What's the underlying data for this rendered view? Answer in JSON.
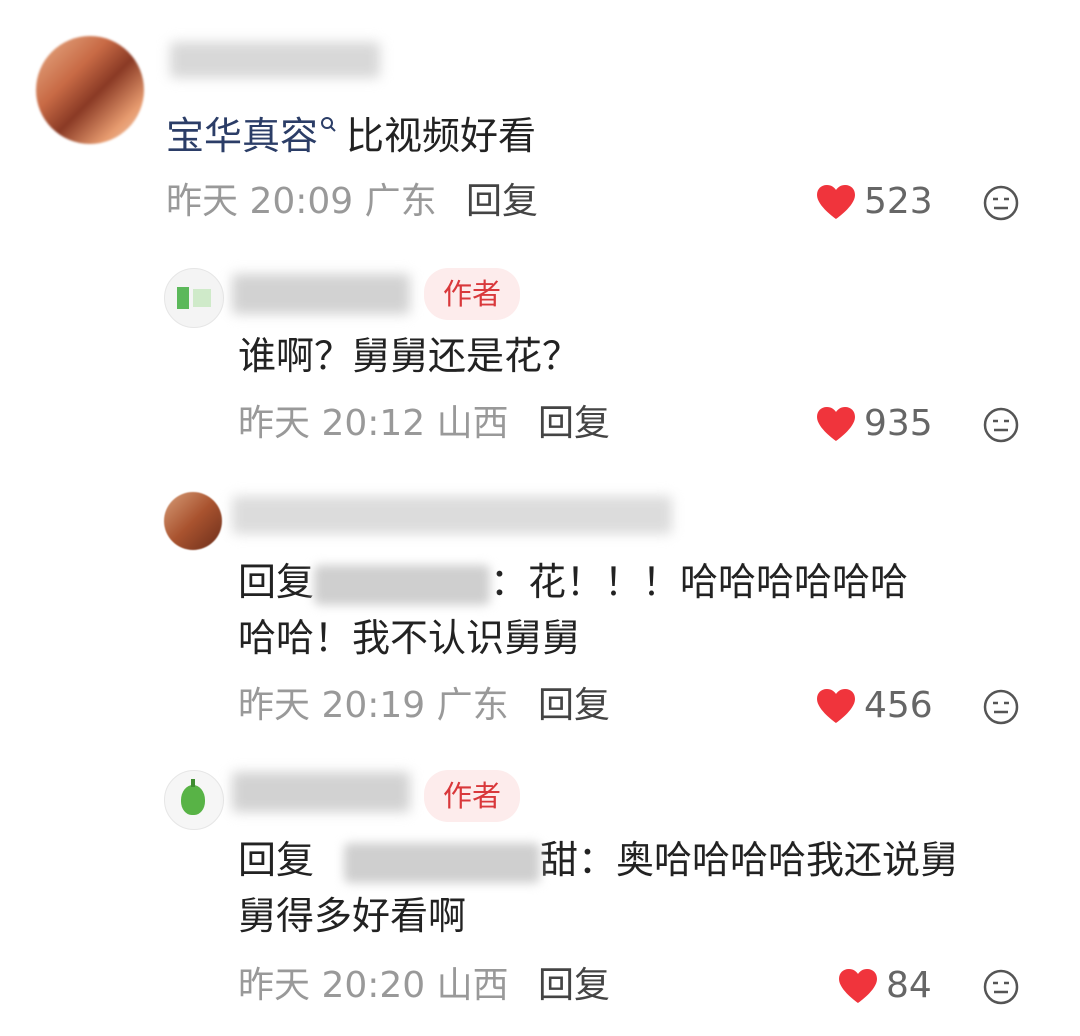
{
  "comments": [
    {
      "mention": "宝华真容",
      "text": "比视频好看",
      "time": "昨天 20:09",
      "region": "广东",
      "reply_label": "回复",
      "likes": "523"
    },
    {
      "badge": "作者",
      "text": "谁啊？舅舅还是花？",
      "time": "昨天 20:12",
      "region": "山西",
      "reply_label": "回复",
      "likes": "935"
    },
    {
      "reply_prefix": "回复",
      "text_after": "：花！！！哈哈哈哈哈哈",
      "text_line2": "哈哈！我不认识舅舅",
      "time": "昨天 20:19",
      "region": "广东",
      "reply_label": "回复",
      "likes": "456"
    },
    {
      "badge": "作者",
      "reply_prefix": "回复",
      "text_after": "甜：奥哈哈哈哈我还说舅",
      "text_line2": "舅得多好看啊",
      "time": "昨天 20:20",
      "region": "山西",
      "reply_label": "回复",
      "likes": "84"
    }
  ],
  "colors": {
    "heart": "#f0343c",
    "author_badge_bg": "#fdecec",
    "author_badge_fg": "#d9383b",
    "mention": "#2b3d67",
    "meta": "#999999"
  },
  "icons": [
    "heart-icon",
    "emoji-icon",
    "search-icon"
  ]
}
